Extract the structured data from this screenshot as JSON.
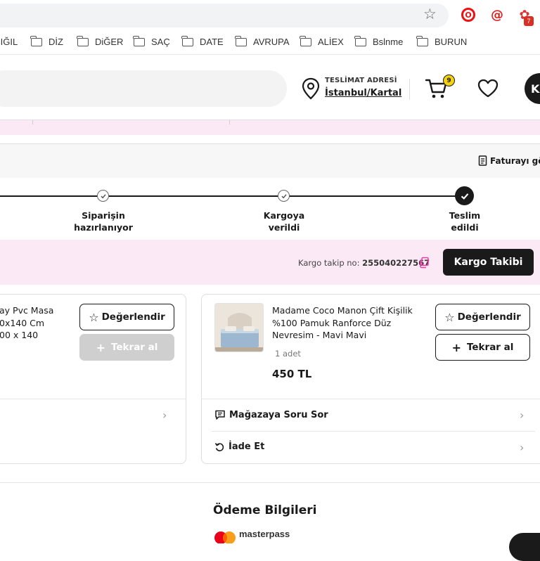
{
  "browser": {
    "star_icon": "star-icon",
    "extensions": [
      {
        "name": "opera-extension-icon",
        "glyph": "O"
      },
      {
        "name": "at-extension-icon",
        "glyph": "@"
      },
      {
        "name": "red-extension-icon",
        "glyph": "✿",
        "badge": "7"
      }
    ]
  },
  "bookmarks": [
    "SIĞIL",
    "DİZ",
    "DiĞER",
    "SAÇ",
    "DATE",
    "AVRUPA",
    "ALİEX",
    "Bslnme",
    "BURUN"
  ],
  "header": {
    "delivery_title": "TESLİMAT ADRESİ",
    "delivery_city": "İstanbul/Kartal",
    "cart_count": "9",
    "avatar_initial": "K"
  },
  "order": {
    "invoice_link": "Faturayı gör",
    "steps": [
      {
        "line1": "Siparişin",
        "line2": "hazırlanıyor",
        "state": "done"
      },
      {
        "line1": "Kargoya",
        "line2": "verildi",
        "state": "done"
      },
      {
        "line1": "Teslim",
        "line2": "edildi",
        "state": "current"
      }
    ],
    "cargo_label": "Kargo takip no:",
    "cargo_number": "255040227567",
    "cargo_button": "Kargo Takibi"
  },
  "products": [
    {
      "name_lines": [
        "ay Pvc Masa",
        "0x140 Cm",
        "00 x 140"
      ],
      "rate_button": "Değerlendir",
      "reorder_button": "Tekrar al",
      "reorder_enabled": false
    },
    {
      "name_lines": [
        "Madame Coco Manon Çift Kişilik",
        "%100 Pamuk Ranforce Düz",
        "Nevresim - Mavi Mavi"
      ],
      "quantity": "1 adet",
      "price": "450 TL",
      "rate_button": "Değerlendir",
      "reorder_button": "Tekrar al",
      "reorder_enabled": true,
      "links": [
        "Mağazaya Soru Sor",
        "İade Et"
      ]
    }
  ],
  "payment": {
    "title": "Ödeme Bilgileri",
    "provider": "masterpass"
  },
  "colors": {
    "pink_bg": "#fbeaf6",
    "dark": "#1a1a1a",
    "cart_badge": "#f5d20e"
  }
}
